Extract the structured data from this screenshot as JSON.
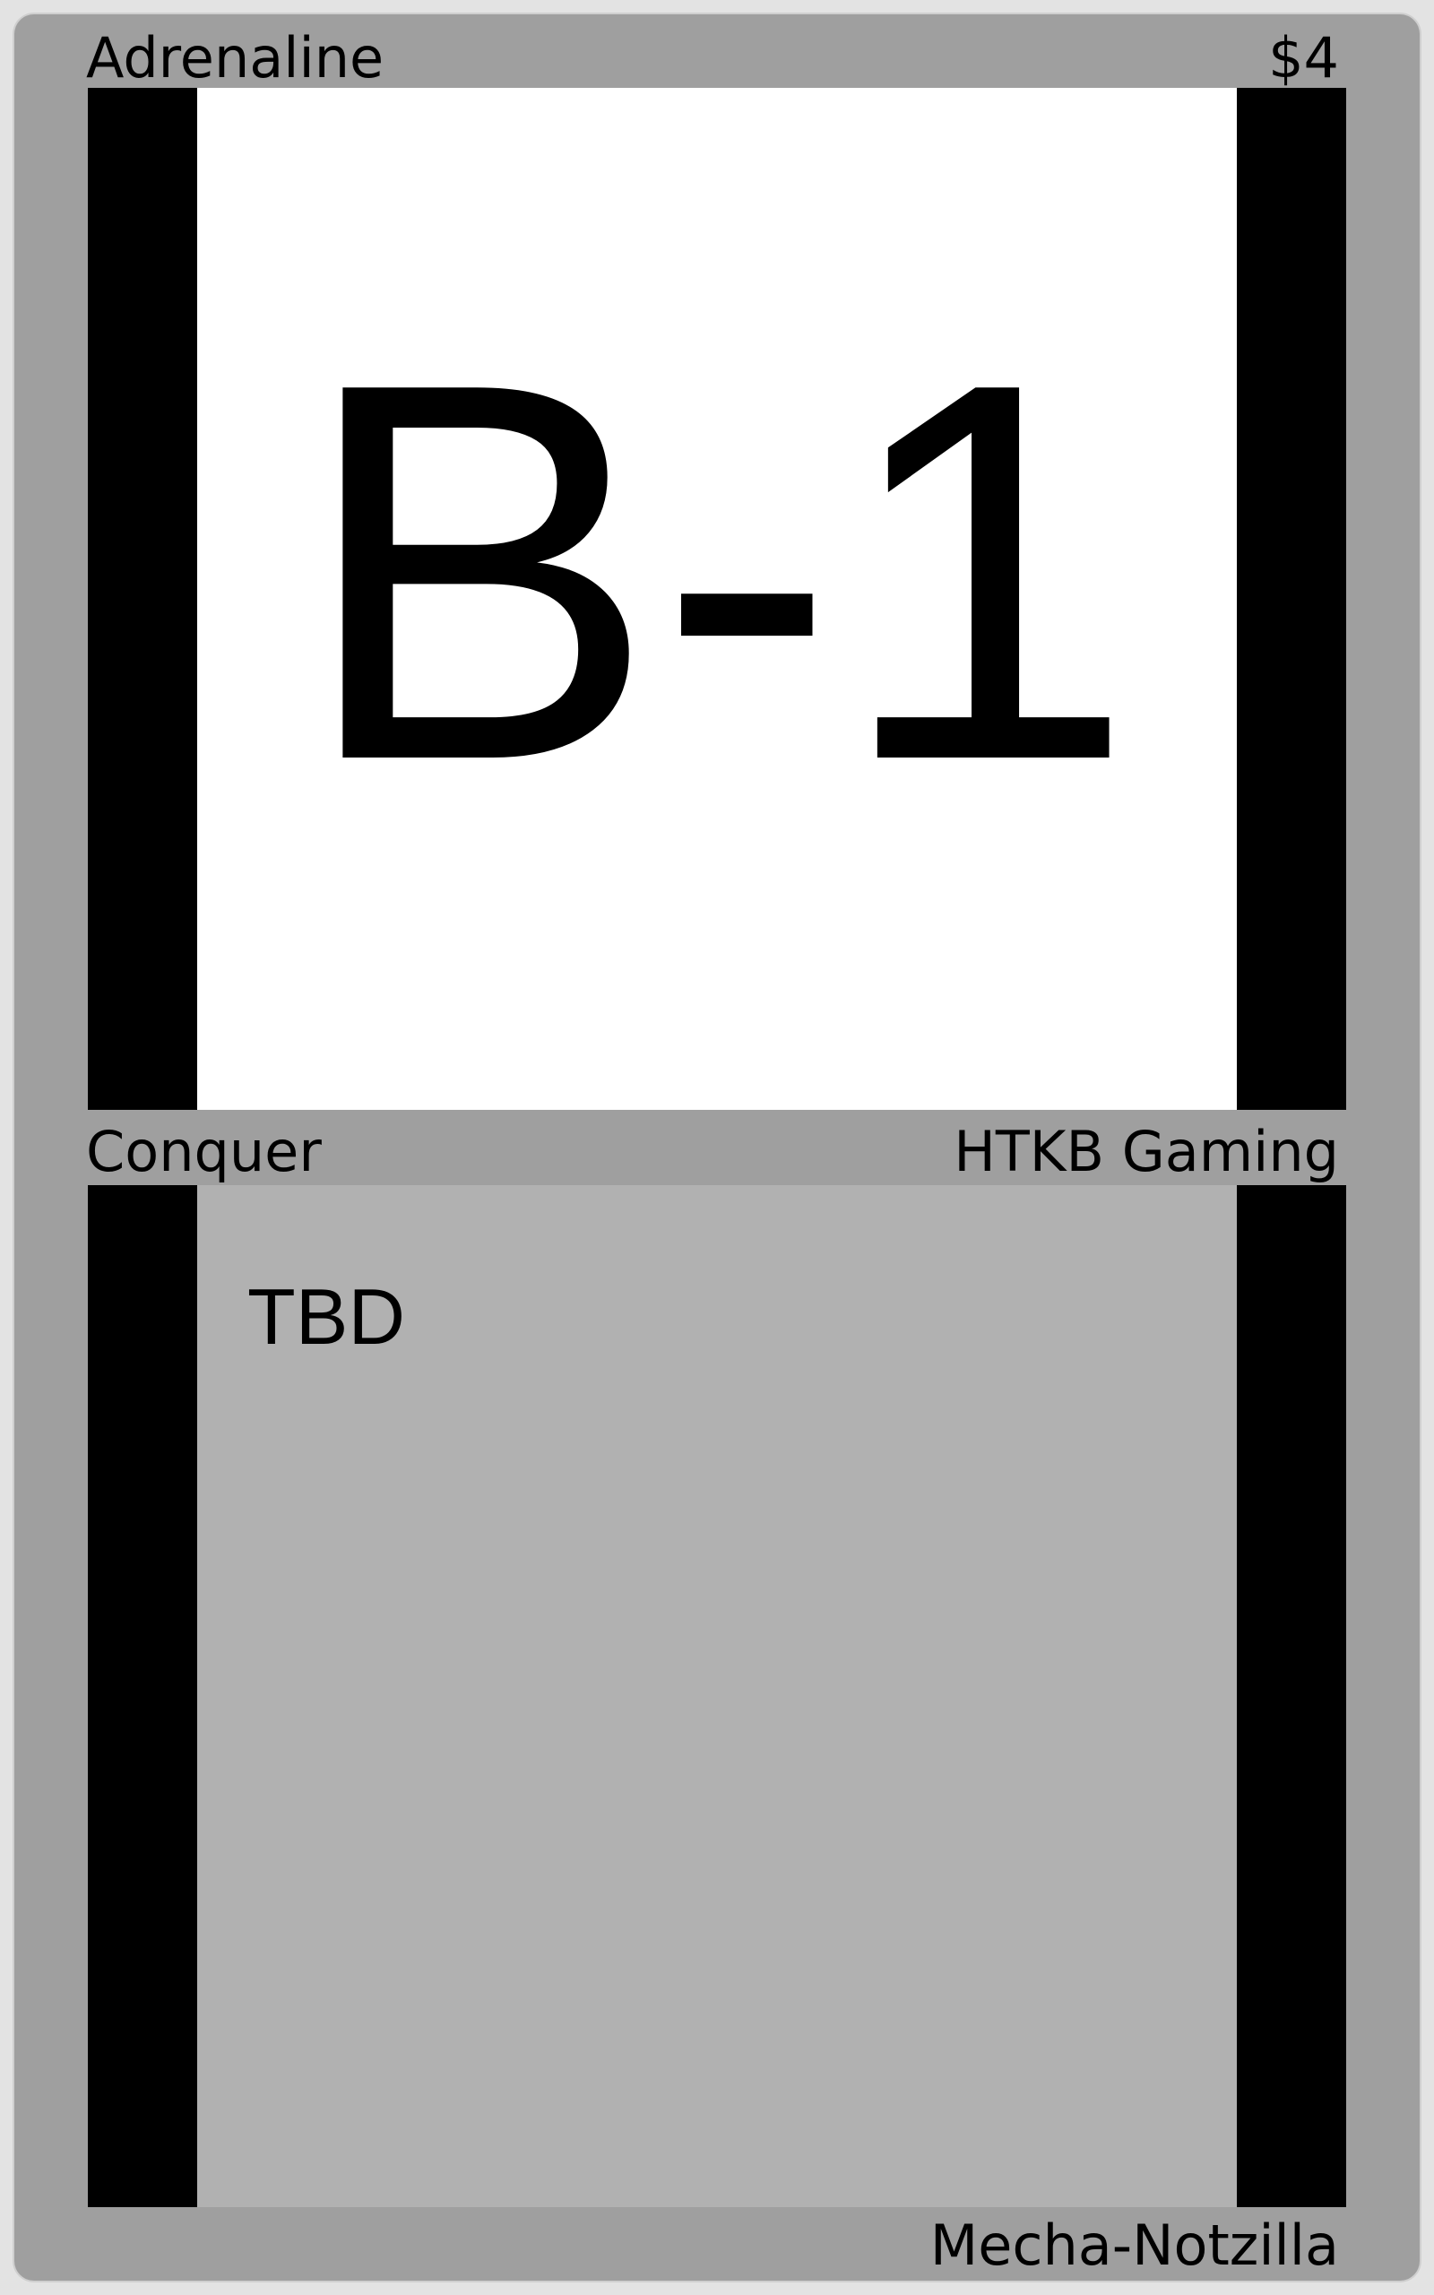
{
  "card": {
    "title": "Adrenaline",
    "cost": "$4",
    "art_text": "B-1",
    "type": "Conquer",
    "publisher": "HTKB Gaming",
    "rules_text": "TBD",
    "artist": "Mecha-Notzilla"
  },
  "colors": {
    "frame": "#9f9f9f",
    "side_bars": "#000000",
    "art_background": "#ffffff",
    "text_box": "#b1b1b1"
  }
}
